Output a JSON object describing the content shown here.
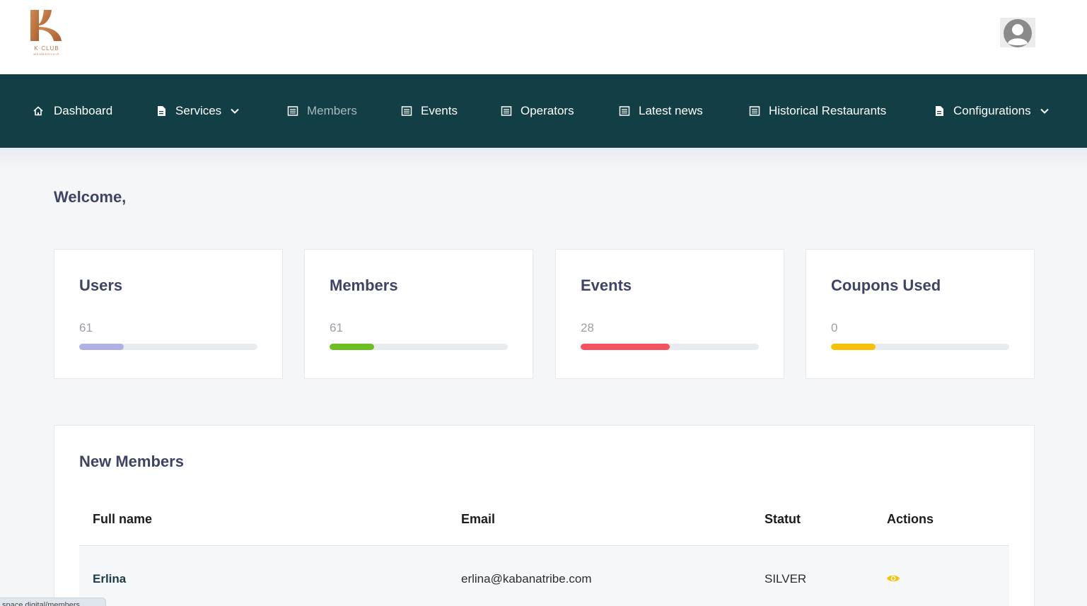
{
  "brand": {
    "logo_text": "K·CLUB",
    "logo_sub": "MEMBERSHIP"
  },
  "nav": {
    "items": [
      {
        "label": "Dashboard",
        "icon": "home-icon",
        "dropdown": false
      },
      {
        "label": "Services",
        "icon": "document-icon",
        "dropdown": true
      },
      {
        "label": "Members",
        "icon": "list-icon",
        "dropdown": false,
        "active": true
      },
      {
        "label": "Events",
        "icon": "list-icon",
        "dropdown": false
      },
      {
        "label": "Operators",
        "icon": "list-icon",
        "dropdown": false
      },
      {
        "label": "Latest news",
        "icon": "list-icon",
        "dropdown": false
      },
      {
        "label": "Historical Restaurants",
        "icon": "list-icon",
        "dropdown": false
      },
      {
        "label": "Configurations",
        "icon": "document-icon",
        "dropdown": true
      }
    ]
  },
  "welcome": "Welcome,",
  "stats": [
    {
      "title": "Users",
      "value": "61",
      "progress_percent": 25,
      "color": "#b1b0e4"
    },
    {
      "title": "Members",
      "value": "61",
      "progress_percent": 25,
      "color": "#6cbf20"
    },
    {
      "title": "Events",
      "value": "28",
      "progress_percent": 50,
      "color": "#f25262"
    },
    {
      "title": "Coupons Used",
      "value": "0",
      "progress_percent": 25,
      "color": "#f7c10a"
    }
  ],
  "new_members": {
    "title": "New Members",
    "columns": [
      "Full name",
      "Email",
      "Statut",
      "Actions"
    ],
    "rows": [
      {
        "full_name": "Erlina",
        "email": "erlina@kabanatribe.com",
        "statut": "SILVER",
        "action_icon": "eye-icon"
      }
    ]
  },
  "status_url": "space.digital/members",
  "colors": {
    "nav_bg": "#113f45",
    "accent": "#c07a45",
    "heading": "#3d4465",
    "eye_icon": "#f7c10a"
  }
}
